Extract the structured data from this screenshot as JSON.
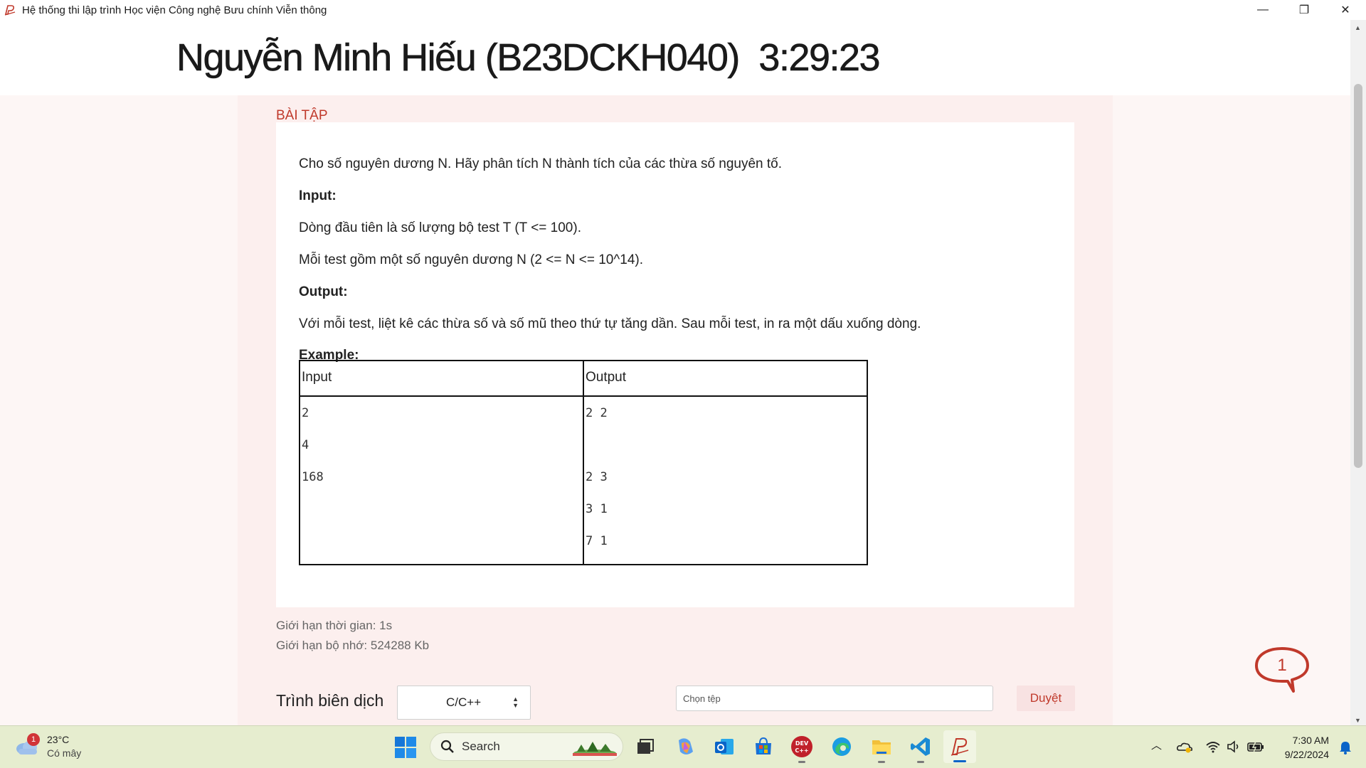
{
  "window": {
    "title": "Hệ thống thi lập trình Học viện Công nghệ Bưu chính Viễn thông",
    "minimize_glyph": "—",
    "maximize_glyph": "❐",
    "close_glyph": "✕"
  },
  "header": {
    "student": "Nguyễn Minh Hiếu (B23DCKH040)",
    "timer": "3:29:23"
  },
  "problem": {
    "section_title": "BÀI TẬP",
    "statement": "Cho số nguyên dương N. Hãy phân tích N thành tích của các thừa số nguyên tố.",
    "input_heading": "Input:",
    "input_line1": "Dòng đầu tiên là số lượng bộ test T (T <= 100).",
    "input_line2": "Mỗi test gồm một số nguyên dương N (2 <= N <= 10^14).",
    "output_heading": "Output:",
    "output_line1": "Với mỗi test, liệt kê các thừa số và số mũ theo thứ tự tăng dần. Sau mỗi test, in ra một dấu xuống dòng.",
    "example_heading": "Example:",
    "example": {
      "headers": [
        "Input",
        "Output"
      ],
      "input_lines": [
        "2",
        "4",
        "168"
      ],
      "output_lines": [
        "2 2",
        "",
        "2 3",
        "3 1",
        "7 1"
      ]
    }
  },
  "limits": {
    "time": "Giới hạn thời gian: 1s",
    "memory": "Giới hạn bộ nhớ: 524288 Kb"
  },
  "submit": {
    "compiler_label": "Trình biên dịch",
    "compiler_value": "C/C++",
    "file_placeholder": "Chọn tệp",
    "browse_label": "Duyệt"
  },
  "chat": {
    "count": "1"
  },
  "taskbar": {
    "weather_temp": "23°C",
    "weather_desc": "Có mây",
    "weather_badge": "1",
    "search_label": "Search",
    "time": "7:30 AM",
    "date": "9/22/2024",
    "icons": [
      "task-view",
      "copilot",
      "outlook",
      "microsoft-store",
      "dev-cpp",
      "edge",
      "file-explorer",
      "vs-code",
      "ptit-code"
    ]
  },
  "colors": {
    "accent": "#c0392b",
    "background": "#fdf6f5",
    "taskbar": "#e6edcf"
  }
}
